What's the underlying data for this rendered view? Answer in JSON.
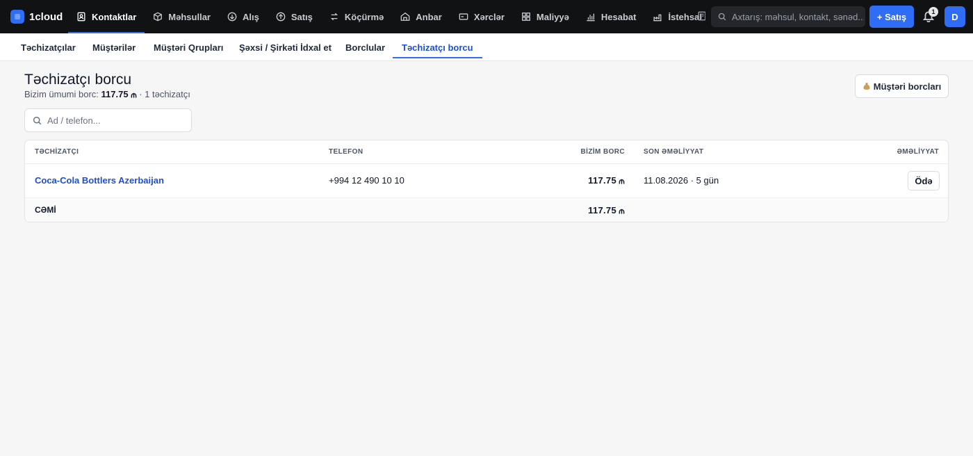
{
  "brand": {
    "name": "1cloud"
  },
  "nav": [
    {
      "label": "Kontaktlar",
      "icon": "contacts-icon",
      "active": true
    },
    {
      "label": "Məhsullar",
      "icon": "box-icon"
    },
    {
      "label": "Alış",
      "icon": "circle-arrow-down-icon"
    },
    {
      "label": "Satış",
      "icon": "circle-arrow-up-icon"
    },
    {
      "label": "Köçürmə",
      "icon": "transfer-icon"
    },
    {
      "label": "Anbar",
      "icon": "warehouse-icon"
    },
    {
      "label": "Xərclər",
      "icon": "wallet-icon"
    },
    {
      "label": "Maliyyə",
      "icon": "grid-icon"
    },
    {
      "label": "Hesabat",
      "icon": "bar-chart-icon"
    },
    {
      "label": "İstehsal",
      "icon": "factory-icon"
    }
  ],
  "search": {
    "placeholder": "Axtarış: məhsul, kontakt, sənəd..."
  },
  "header_actions": {
    "sale_button": "+ Satış",
    "notifications_count": "1",
    "avatar_initial": "D"
  },
  "subnav": [
    {
      "label": "Təchizatçılar"
    },
    {
      "label": "Müştərilər"
    },
    {
      "label": "Müştəri Qrupları"
    },
    {
      "label": "Şəxsi / Şirkəti İdxal et"
    },
    {
      "label": "Borclular"
    },
    {
      "label": "Təchizatçı borcu",
      "active": true
    }
  ],
  "page": {
    "title": "Təchizatçı borcu",
    "subtitle_prefix": "Bizim ümumi borc: ",
    "subtitle_amount": "117.75",
    "subtitle_suffix": " · 1 təchizatçı",
    "customer_debts_button": "Müştəri borcları",
    "filter_placeholder": "Ad / telefon..."
  },
  "table": {
    "columns": [
      "TƏCHİZATÇI",
      "TELEFON",
      "BİZİM BORC",
      "SON ƏMƏLİYYAT",
      "ƏMƏLİYYAT"
    ],
    "rows": [
      {
        "supplier": "Coca-Cola Bottlers Azerbaijan",
        "phone": "+994 12 490 10 10",
        "debt": "117.75",
        "last_operation": "11.08.2026 · 5 gün",
        "action": "Ödə"
      }
    ],
    "total": {
      "label": "CƏMİ",
      "debt": "117.75"
    }
  },
  "colors": {
    "accent": "#2f6df6",
    "topbar": "#111214",
    "link": "#1d4ed8"
  }
}
